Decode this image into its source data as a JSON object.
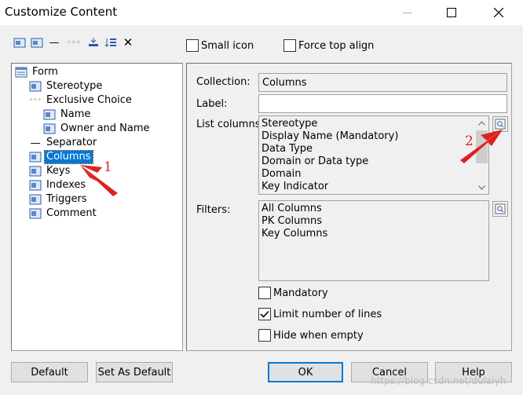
{
  "window": {
    "title": "Customize Content",
    "minimize_glyph": "—",
    "maximize_glyph": "☐",
    "close_glyph": "✕"
  },
  "toolbar": {
    "icons": [
      "add-object-icon",
      "add-object-icon",
      "add-separator-icon",
      "add-exclusive-choice-icon",
      "move-icon",
      "sort-icon",
      "delete-icon"
    ],
    "delete_glyph": "✕",
    "separator_glyph": "—",
    "choice_glyph": "◦◦◦"
  },
  "options": {
    "small_icon": {
      "label": "Small icon",
      "checked": false
    },
    "force_top_align": {
      "label": "Force top align",
      "checked": false
    }
  },
  "tree": {
    "items": [
      {
        "label": "Form",
        "icon": "form-icon"
      },
      {
        "label": "Stereotype",
        "icon": "object-icon"
      },
      {
        "label": "Exclusive Choice",
        "icon": "choice-icon"
      },
      {
        "label": "Name",
        "icon": "object-icon"
      },
      {
        "label": "Owner and Name",
        "icon": "object-icon"
      },
      {
        "label": "Separator",
        "icon": "separator-icon"
      },
      {
        "label": "Columns",
        "icon": "object-icon",
        "selected": true
      },
      {
        "label": "Keys",
        "icon": "object-icon"
      },
      {
        "label": "Indexes",
        "icon": "object-icon"
      },
      {
        "label": "Triggers",
        "icon": "object-icon"
      },
      {
        "label": "Comment",
        "icon": "object-icon"
      }
    ],
    "separator_glyph": "—",
    "choice_glyph": "◦◦◦"
  },
  "properties": {
    "collection_label": "Collection:",
    "collection_value": "Columns",
    "label_label": "Label:",
    "label_value": "",
    "list_columns_label": "List columns:",
    "list_columns": [
      "Stereotype",
      "Display Name (Mandatory)",
      "Data Type",
      "Domain or Data type",
      "Domain",
      "Key Indicator"
    ],
    "filters_label": "Filters:",
    "filters": [
      "All Columns",
      "PK Columns",
      "Key Columns"
    ],
    "mandatory": {
      "label": "Mandatory",
      "checked": false
    },
    "limit_lines": {
      "label": "Limit number of lines",
      "checked": true
    },
    "hide_empty": {
      "label": "Hide when empty",
      "checked": false
    },
    "check_glyph": "✓",
    "scroll_up_glyph": "⌃",
    "scroll_down_glyph": "⌄"
  },
  "buttons": {
    "default": "Default",
    "set_as_default": "Set As Default",
    "ok": "OK",
    "cancel": "Cancel",
    "help": "Help"
  },
  "annotations": {
    "one": "1",
    "two": "2",
    "color": "#e02020"
  },
  "watermark": "https://blog.csdn.net/dulaiyh",
  "colors": {
    "selection": "#0078d7",
    "dialog_bg": "#f0f0f0",
    "accent": "#0078d7"
  }
}
